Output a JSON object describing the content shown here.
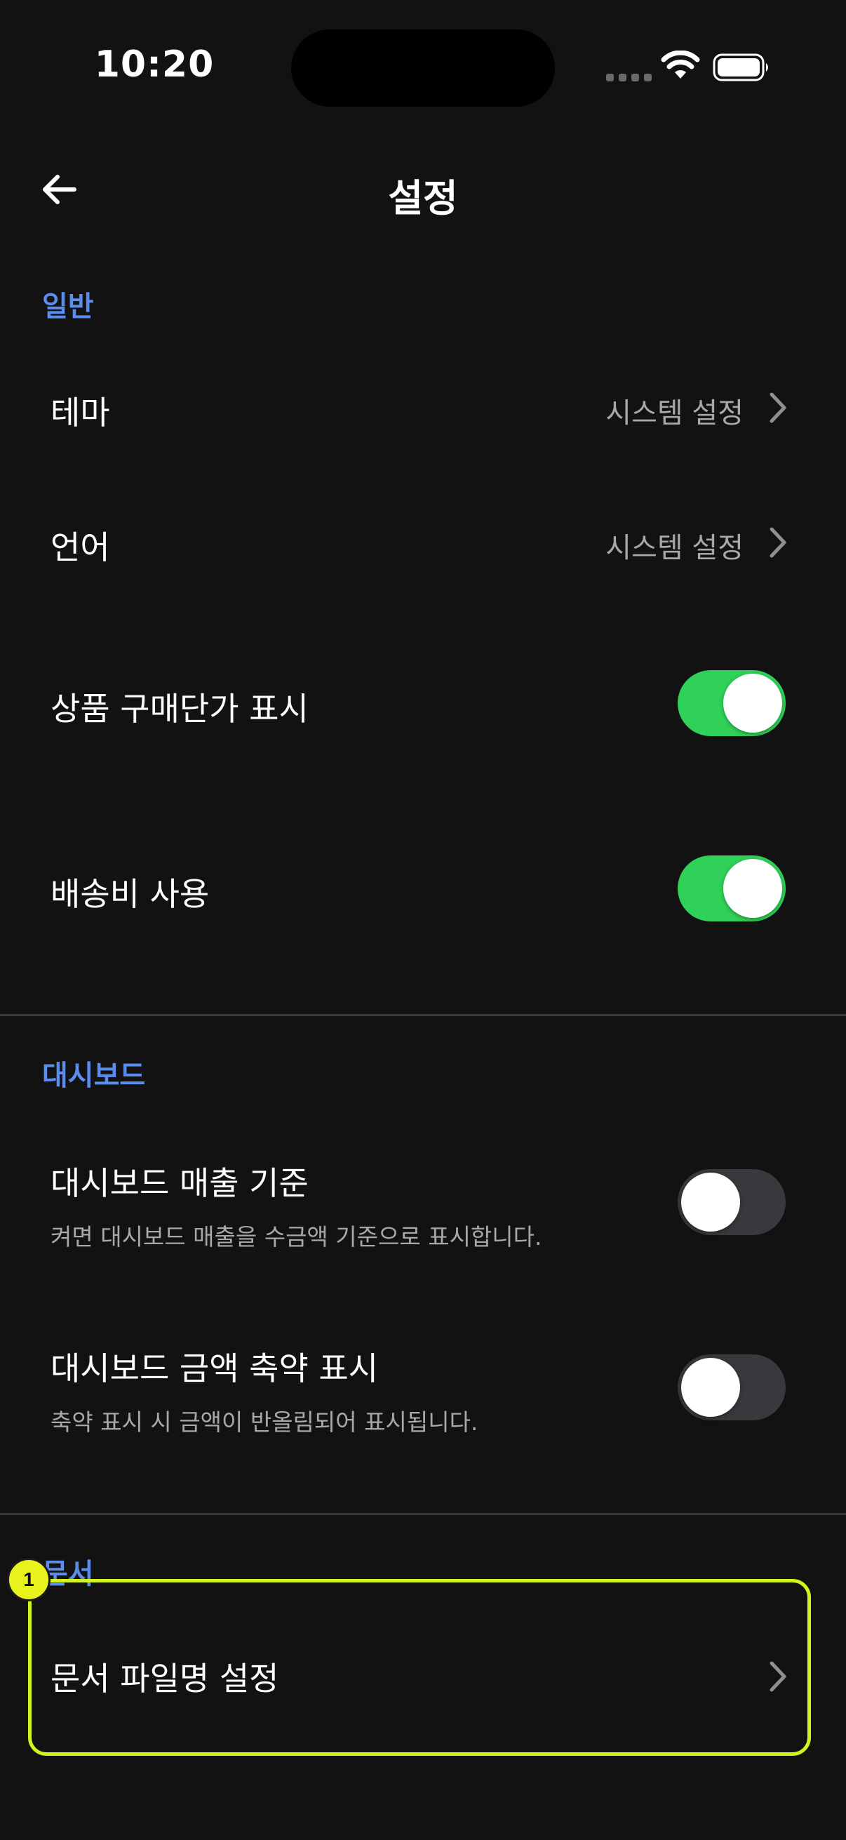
{
  "status_bar": {
    "time": "10:20"
  },
  "nav": {
    "title": "설정"
  },
  "colors": {
    "background": "#121212",
    "section_header": "#5b8def",
    "toggle_on": "#30d158",
    "toggle_off": "#39393d",
    "highlight": "#d4f21c"
  },
  "sections": {
    "general": {
      "header": "일반",
      "theme": {
        "label": "테마",
        "value": "시스템 설정"
      },
      "language": {
        "label": "언어",
        "value": "시스템 설정"
      },
      "show_purchase_price": {
        "label": "상품 구매단가 표시",
        "enabled": true
      },
      "use_shipping_fee": {
        "label": "배송비 사용",
        "enabled": true
      }
    },
    "dashboard": {
      "header": "대시보드",
      "sales_basis": {
        "label": "대시보드 매출 기준",
        "description": "켜면 대시보드 매출을 수금액 기준으로 표시합니다.",
        "enabled": false
      },
      "abbreviate_amount": {
        "label": "대시보드 금액 축약 표시",
        "description": "축약 표시 시 금액이 반올림되어 표시됩니다.",
        "enabled": false
      }
    },
    "documents": {
      "header": "문서",
      "filename_settings": {
        "label": "문서 파일명 설정"
      }
    }
  },
  "annotation": {
    "badge": "1"
  }
}
